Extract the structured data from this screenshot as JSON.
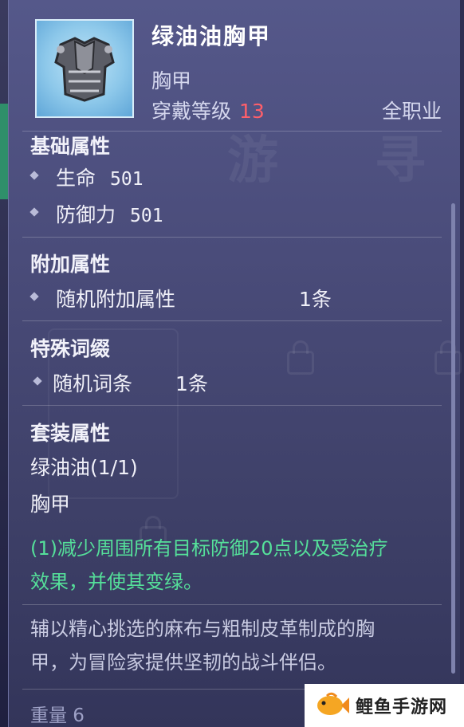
{
  "item": {
    "name": "绿油油胸甲",
    "type": "胸甲",
    "req_label": "穿戴等级",
    "req_level": "13",
    "class": "全职业"
  },
  "base": {
    "title": "基础属性",
    "attrs": [
      {
        "label": "生命",
        "value": "501"
      },
      {
        "label": "防御力",
        "value": "501"
      }
    ]
  },
  "extra": {
    "title": "附加属性",
    "label": "随机附加属性",
    "value": "1条"
  },
  "affix": {
    "title": "特殊词缀",
    "label": "随机词条",
    "value": "1条"
  },
  "set": {
    "title": "套装属性",
    "name": "绿油油(1/1)",
    "piece": "胸甲",
    "bonus_line1": "(1)减少周围所有目标防御20点以及受治疗",
    "bonus_line2": "效果，并使其变绿。"
  },
  "description": {
    "line1": "辅以精心挑选的麻布与粗制皮革制成的胸",
    "line2": "甲，为冒险家提供坚韧的战斗伴侣。"
  },
  "weight_text": "重量 6",
  "watermark": "鲤鱼手游网",
  "colors": {
    "level_red": "#ff5f6a",
    "set_bonus_green": "#55e09a"
  }
}
